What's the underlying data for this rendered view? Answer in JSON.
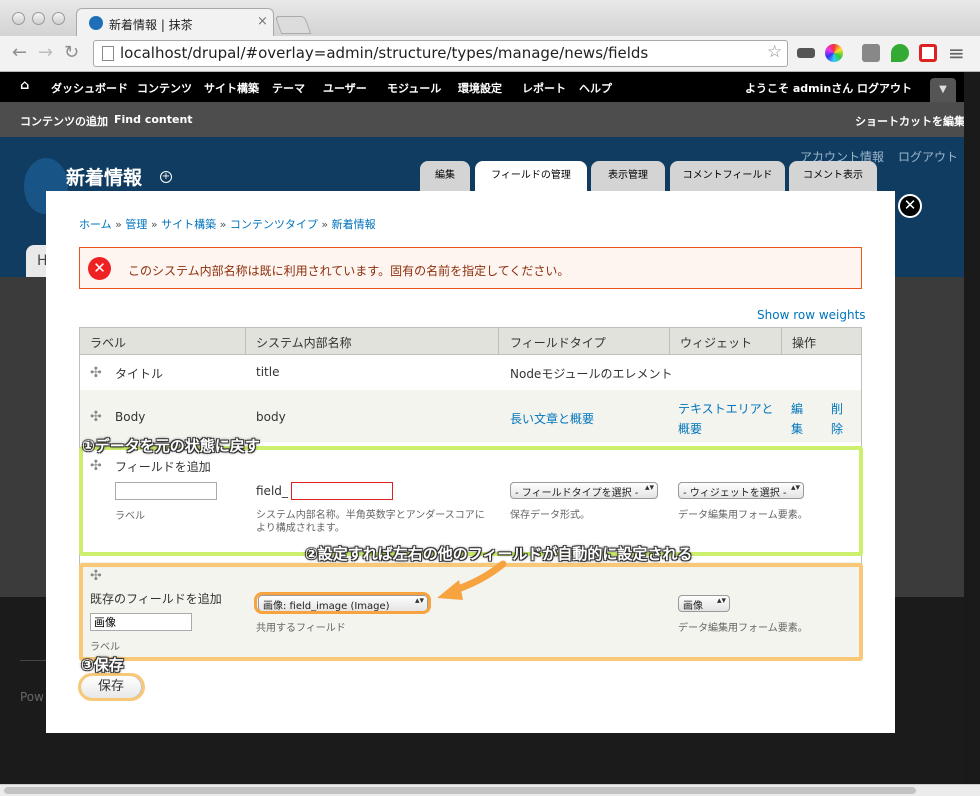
{
  "browser": {
    "tab_title": "新着情報 | 抹茶",
    "tab_close": "×",
    "url": "localhost/drupal/#overlay=admin/structure/types/manage/news/fields",
    "back": "←",
    "forward": "→",
    "reload": "↻",
    "star": "☆"
  },
  "admin_menu": {
    "home": "⌂",
    "items": [
      "ダッシュボード",
      "コンテンツ",
      "サイト構築",
      "テーマ",
      "ユーザー",
      "モジュール",
      "環境設定",
      "レポート",
      "ヘルプ"
    ],
    "welcome": "ようこそ adminさん",
    "logout": "ログアウト"
  },
  "shortcuts": {
    "add_content": "コンテンツの追加",
    "find_content": "Find content",
    "edit_shortcuts": "ショートカットを編集"
  },
  "page": {
    "site_name": "新着情報",
    "add_shortcut": "+",
    "account_link": "アカウント情報",
    "logout_link": "ログアウト",
    "tabs": [
      "編集",
      "フィールドの管理",
      "表示管理",
      "コメントフィールド",
      "コメント表示"
    ],
    "under_tab": "H",
    "powered": "Pow"
  },
  "overlay": {
    "close": "✕",
    "breadcrumb": [
      "ホーム",
      "管理",
      "サイト構築",
      "コンテンツタイプ",
      "新着情報"
    ],
    "breadcrumb_sep": " » ",
    "error_icon": "✕",
    "error_message": "このシステム内部名称は既に利用されています。固有の名前を指定してください。",
    "show_row_weights": "Show row weights",
    "table": {
      "headers": [
        "ラベル",
        "システム内部名称",
        "フィールドタイプ",
        "ウィジェット",
        "操作"
      ],
      "drag_icon": "✣",
      "title_row": {
        "label": "タイトル",
        "name": "title",
        "type": "Nodeモジュールのエレメント"
      },
      "body_row": {
        "label": "Body",
        "name": "body",
        "type": "長い文章と概要",
        "widget_line1": "テキストエリアと",
        "widget_line2": "概要",
        "edit1": "編",
        "edit2": "集",
        "delete1": "削",
        "delete2": "除"
      },
      "new_field": {
        "title": "フィールドを追加",
        "label_value": "",
        "label_desc": "ラベル",
        "prefix": "field_",
        "name_value": "",
        "name_desc_1": "システム内部名称。半角英数字とアンダースコアに",
        "name_desc_2": "より構成されます。",
        "type_select": "- フィールドタイプを選択 -",
        "type_desc": "保存データ形式。",
        "widget_select": "- ウィジェットを選択 -",
        "widget_desc": "データ編集用フォーム要素。"
      },
      "existing_field": {
        "title": "既存のフィールドを追加",
        "label_value": "画像",
        "label_desc": "ラベル",
        "field_select": "画像: field_image (Image)",
        "field_desc": "共用するフィールド",
        "widget_select": "画像",
        "widget_desc": "データ編集用フォーム要素。"
      }
    },
    "save_button": "保存"
  },
  "annotations": {
    "step1": "①データを元の状態に戻す",
    "step2": "②設定すれば左右の他のフィールドが自動的に設定される",
    "step3": "③保存"
  },
  "colors": {
    "green_highlight": "#ccef6e",
    "orange_highlight": "#f8c878",
    "arrow": "#f7a33f",
    "link": "#0074bd",
    "error_border": "#ed541d"
  }
}
